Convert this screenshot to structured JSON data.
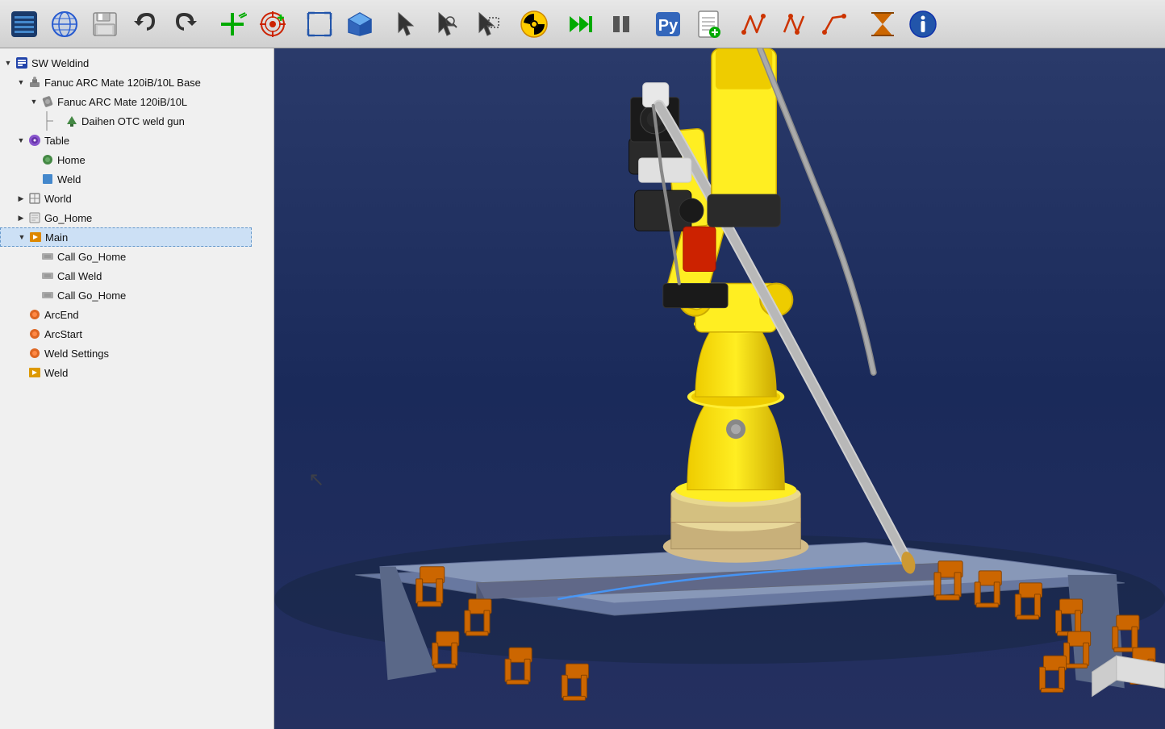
{
  "app": {
    "title": "SW Weldind"
  },
  "toolbar": {
    "buttons": [
      {
        "id": "app-icon",
        "icon": "🔷",
        "label": "App Icon",
        "interactable": false
      },
      {
        "id": "globe",
        "icon": "🌐",
        "label": "World",
        "interactable": true
      },
      {
        "id": "save",
        "icon": "💾",
        "label": "Save",
        "interactable": true
      },
      {
        "id": "undo",
        "icon": "↩",
        "label": "Undo",
        "interactable": true
      },
      {
        "id": "redo",
        "icon": "↪",
        "label": "Redo",
        "interactable": true
      },
      {
        "id": "sep1",
        "icon": "",
        "label": "",
        "interactable": false,
        "sep": true
      },
      {
        "id": "add-axis",
        "icon": "➕",
        "label": "Add Axis",
        "interactable": true
      },
      {
        "id": "target",
        "icon": "🎯",
        "label": "Target",
        "interactable": true
      },
      {
        "id": "sep2",
        "icon": "",
        "label": "",
        "interactable": false,
        "sep": true
      },
      {
        "id": "fit",
        "icon": "⛶",
        "label": "Fit",
        "interactable": true
      },
      {
        "id": "cube",
        "icon": "⬛",
        "label": "Cube View",
        "interactable": true
      },
      {
        "id": "sep3",
        "icon": "",
        "label": "",
        "interactable": false,
        "sep": true
      },
      {
        "id": "select",
        "icon": "↖",
        "label": "Select",
        "interactable": true
      },
      {
        "id": "select2",
        "icon": "↗",
        "label": "Select 2",
        "interactable": true
      },
      {
        "id": "select3",
        "icon": "↙",
        "label": "Select 3",
        "interactable": true
      },
      {
        "id": "sep4",
        "icon": "",
        "label": "",
        "interactable": false,
        "sep": true
      },
      {
        "id": "hazard",
        "icon": "☢",
        "label": "Hazard",
        "interactable": true
      },
      {
        "id": "sep5",
        "icon": "",
        "label": "",
        "interactable": false,
        "sep": true
      },
      {
        "id": "play",
        "icon": "▶▶",
        "label": "Play",
        "interactable": true
      },
      {
        "id": "pause",
        "icon": "⏸",
        "label": "Pause",
        "interactable": true
      },
      {
        "id": "sep6",
        "icon": "",
        "label": "",
        "interactable": false,
        "sep": true
      },
      {
        "id": "python",
        "icon": "🐍",
        "label": "Python",
        "interactable": true
      },
      {
        "id": "doc",
        "icon": "📋",
        "label": "Document",
        "interactable": true
      },
      {
        "id": "sep7",
        "icon": "",
        "label": "",
        "interactable": false,
        "sep": true
      },
      {
        "id": "path1",
        "icon": "〰",
        "label": "Path 1",
        "interactable": true
      },
      {
        "id": "path2",
        "icon": "〰",
        "label": "Path 2",
        "interactable": true
      },
      {
        "id": "path3",
        "icon": "〰",
        "label": "Path 3",
        "interactable": true
      },
      {
        "id": "sep8",
        "icon": "",
        "label": "",
        "interactable": false,
        "sep": true
      },
      {
        "id": "timer",
        "icon": "⏳",
        "label": "Timer",
        "interactable": true
      },
      {
        "id": "info",
        "icon": "ℹ",
        "label": "Info",
        "interactable": true
      }
    ]
  },
  "tree": {
    "items": [
      {
        "id": "sw-weldind",
        "label": "SW Weldind",
        "level": 0,
        "arrow": "▼",
        "icon": "📦",
        "type": "root"
      },
      {
        "id": "fanuc-base",
        "label": "Fanuc ARC Mate 120iB/10L Base",
        "level": 1,
        "arrow": "▼",
        "icon": "🤖",
        "type": "robot-base"
      },
      {
        "id": "fanuc-arm",
        "label": "Fanuc ARC Mate 120iB/10L",
        "level": 2,
        "arrow": "▼",
        "icon": "🔧",
        "type": "robot-arm"
      },
      {
        "id": "weld-gun",
        "label": "Daihen OTC weld gun",
        "level": 3,
        "arrow": "",
        "icon": "🔫",
        "type": "tool",
        "connector": true
      },
      {
        "id": "table",
        "label": "Table",
        "level": 1,
        "arrow": "▼",
        "icon": "🟣",
        "type": "table"
      },
      {
        "id": "home",
        "label": "Home",
        "level": 2,
        "arrow": "",
        "icon": "🟢",
        "type": "position"
      },
      {
        "id": "weld",
        "label": "Weld",
        "level": 2,
        "arrow": "",
        "icon": "🔵",
        "type": "position"
      },
      {
        "id": "world",
        "label": "World",
        "level": 1,
        "arrow": "▶",
        "icon": "⬜",
        "type": "world"
      },
      {
        "id": "go-home",
        "label": "Go_Home",
        "level": 1,
        "arrow": "▶",
        "icon": "📄",
        "type": "program"
      },
      {
        "id": "main",
        "label": "Main",
        "level": 1,
        "arrow": "▼",
        "icon": "📂",
        "type": "program",
        "selected": true
      },
      {
        "id": "call-go-home-1",
        "label": "Call Go_Home",
        "level": 2,
        "arrow": "",
        "icon": "≡",
        "type": "call"
      },
      {
        "id": "call-weld",
        "label": "Call Weld",
        "level": 2,
        "arrow": "",
        "icon": "≡",
        "type": "call"
      },
      {
        "id": "call-go-home-2",
        "label": "Call Go_Home",
        "level": 2,
        "arrow": "",
        "icon": "≡",
        "type": "call"
      },
      {
        "id": "arc-end",
        "label": "ArcEnd",
        "level": 1,
        "arrow": "",
        "icon": "🟠",
        "type": "arc"
      },
      {
        "id": "arc-start",
        "label": "ArcStart",
        "level": 1,
        "arrow": "",
        "icon": "🟠",
        "type": "arc"
      },
      {
        "id": "weld-settings",
        "label": "Weld Settings",
        "level": 1,
        "arrow": "",
        "icon": "🟠",
        "type": "weld-settings"
      },
      {
        "id": "weld-prog",
        "label": "Weld",
        "level": 1,
        "arrow": "",
        "icon": "🟡",
        "type": "weld-program"
      }
    ]
  },
  "viewport": {
    "background_top": "#2a3a6a",
    "background_bottom": "#1a2a5a"
  }
}
